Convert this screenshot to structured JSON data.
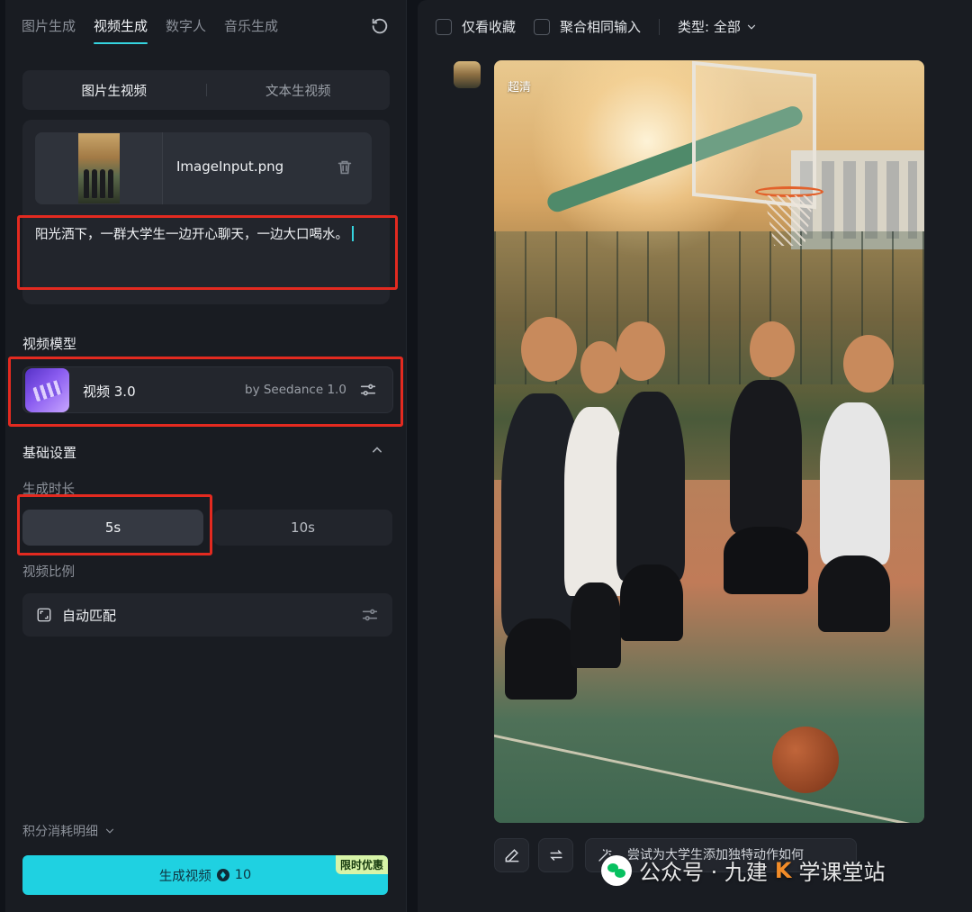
{
  "nav": {
    "tabs": [
      {
        "label": "图片生成"
      },
      {
        "label": "视频生成"
      },
      {
        "label": "数字人"
      },
      {
        "label": "音乐生成"
      }
    ],
    "active_tab": "视频生成"
  },
  "mode_switch": {
    "options": [
      {
        "label": "图片生视频"
      },
      {
        "label": "文本生视频"
      }
    ],
    "active": "图片生视频"
  },
  "upload": {
    "file_name": "ImageInput.png"
  },
  "prompt": {
    "text": "阳光洒下，一群大学生一边开心聊天，一边大口喝水。"
  },
  "model_section": {
    "label": "视频模型",
    "model_name": "视频 3.0",
    "provider": "by Seedance 1.0"
  },
  "basic_settings": {
    "label": "基础设置",
    "duration_label": "生成时长",
    "durations": [
      {
        "label": "5s"
      },
      {
        "label": "10s"
      }
    ],
    "selected_duration": "5s",
    "ratio_label": "视频比例",
    "ratio_value": "自动匹配"
  },
  "footer": {
    "credits_label": "积分消耗明细",
    "generate_label": "生成视频",
    "cost": "10",
    "promo_badge": "限时优惠"
  },
  "result_toolbar": {
    "favorites_only": "仅看收藏",
    "merge_same_input": "聚合相同输入",
    "type_filter": "类型: 全部"
  },
  "result": {
    "quality_badge": "超清",
    "suggestion": "尝试为大学生添加独特动作如何"
  },
  "watermark": {
    "text": "公众号 · 九建",
    "suffix": "学课堂站"
  },
  "colors": {
    "accent": "#1fd1e1",
    "highlight_box": "#e32a20",
    "panel_bg": "#191c22",
    "page_bg": "#101319"
  }
}
